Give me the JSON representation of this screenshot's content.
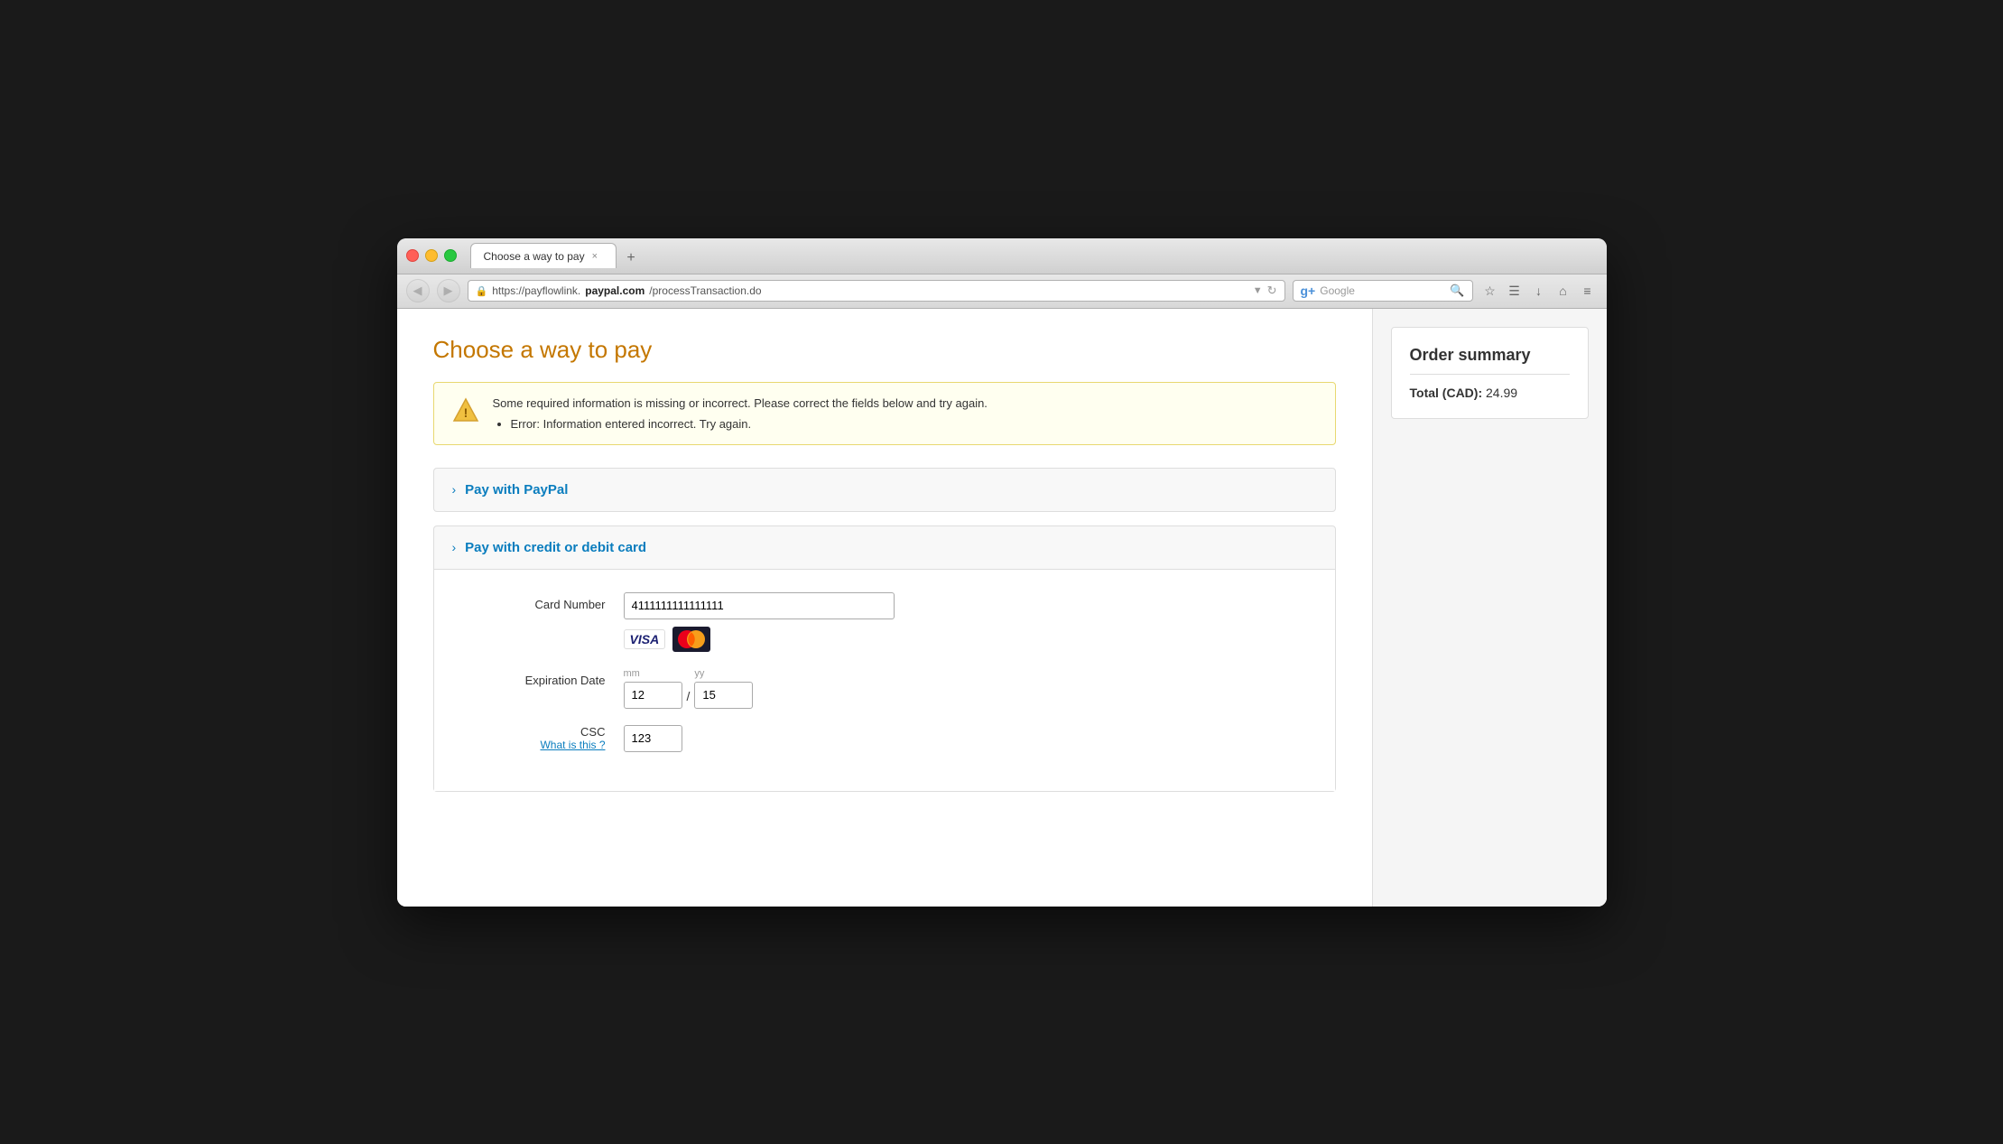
{
  "browser": {
    "tab_title": "Choose a way to pay",
    "tab_close": "×",
    "tab_new": "+",
    "address": "https://payflowlink.",
    "address_bold": "paypal.com",
    "address_rest": "/processTransaction.do",
    "search_placeholder": "Google",
    "back_btn": "‹",
    "refresh_btn": "↻",
    "chevron_btn": "⌄"
  },
  "page": {
    "title": "Choose a way to pay",
    "error": {
      "main_message": "Some required information is missing or incorrect. Please correct the fields below and try again.",
      "error_item": "Error: Information entered incorrect. Try again."
    },
    "paypal_section": {
      "title": "Pay with PayPal"
    },
    "card_section": {
      "title": "Pay with credit or debit card",
      "card_number_label": "Card Number",
      "card_number_value": "4111111111111111",
      "expiration_label": "Expiration Date",
      "exp_month_placeholder": "mm",
      "exp_month_value": "12",
      "exp_year_placeholder": "yy",
      "exp_year_value": "15",
      "csc_label": "CSC",
      "csc_link": "What is this ?",
      "csc_value": "123"
    }
  },
  "sidebar": {
    "order_summary_title": "Order summary",
    "total_label": "Total (CAD):",
    "total_value": "24.99"
  }
}
